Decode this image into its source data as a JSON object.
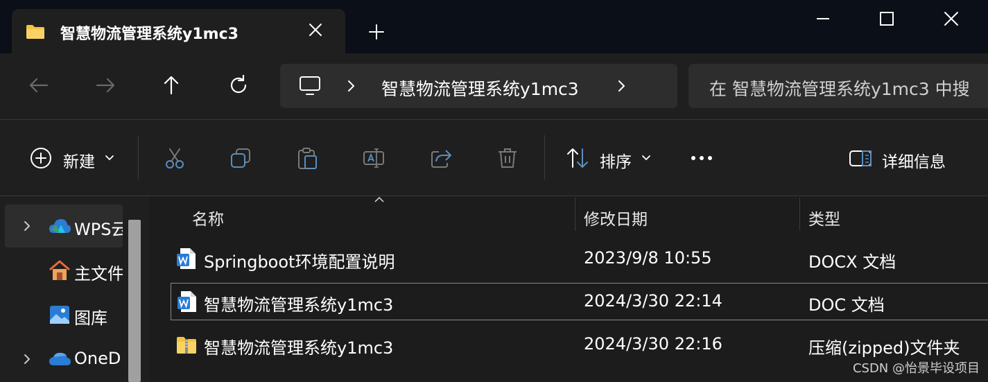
{
  "window": {
    "tab_title": "智慧物流管理系统y1mc3",
    "tab_icon": "folder-icon",
    "new_tab_icon": "plus-icon",
    "controls": [
      "minimize-icon",
      "maximize-icon",
      "close-icon"
    ]
  },
  "navigation": {
    "back_icon": "arrow-left-icon",
    "forward_icon": "arrow-right-icon",
    "up_icon": "arrow-up-icon",
    "refresh_icon": "refresh-icon",
    "address": {
      "root_icon": "monitor-icon",
      "segment": "智慧物流管理系统y1mc3"
    },
    "search": {
      "placeholder": "在 智慧物流管理系统y1mc3 中搜"
    }
  },
  "command_bar": {
    "new_label": "新建",
    "sort_label": "排序",
    "details_label": "详细信息",
    "actions": [
      "cut-icon",
      "copy-icon",
      "paste-icon",
      "rename-icon",
      "share-icon",
      "delete-icon"
    ],
    "more_icon": "more-icon"
  },
  "sidebar": {
    "items": [
      {
        "label": "WPS云",
        "icon": "cloud-icon",
        "expandable": true,
        "selected": true
      },
      {
        "label": "主文件",
        "icon": "home-icon",
        "expandable": false,
        "selected": false
      },
      {
        "label": "图库",
        "icon": "gallery-icon",
        "expandable": false,
        "selected": false
      },
      {
        "label": "OneD",
        "icon": "onedrive-icon",
        "expandable": true,
        "selected": false
      }
    ]
  },
  "file_list": {
    "columns": [
      "名称",
      "修改日期",
      "类型"
    ],
    "rows": [
      {
        "name": "Springboot环境配置说明",
        "modified": "2023/9/8 10:55",
        "type": "DOCX 文档",
        "icon": "word-doc-icon",
        "selected": false
      },
      {
        "name": "智慧物流管理系统y1mc3",
        "modified": "2024/3/30 22:14",
        "type": "DOC 文档",
        "icon": "word-doc-icon",
        "selected": true
      },
      {
        "name": "智慧物流管理系统y1mc3",
        "modified": "2024/3/30 22:16",
        "type": "压缩(zipped)文件夹",
        "icon": "zip-folder-icon",
        "selected": false
      }
    ]
  },
  "watermark": "CSDN @怡景毕设项目",
  "colors": {
    "titlebar": "#0b0f17",
    "panel": "#1f1f1f",
    "field": "#2d2d2d",
    "accent_blue": "#2b7cd3",
    "folder_yellow": "#f5c142"
  }
}
